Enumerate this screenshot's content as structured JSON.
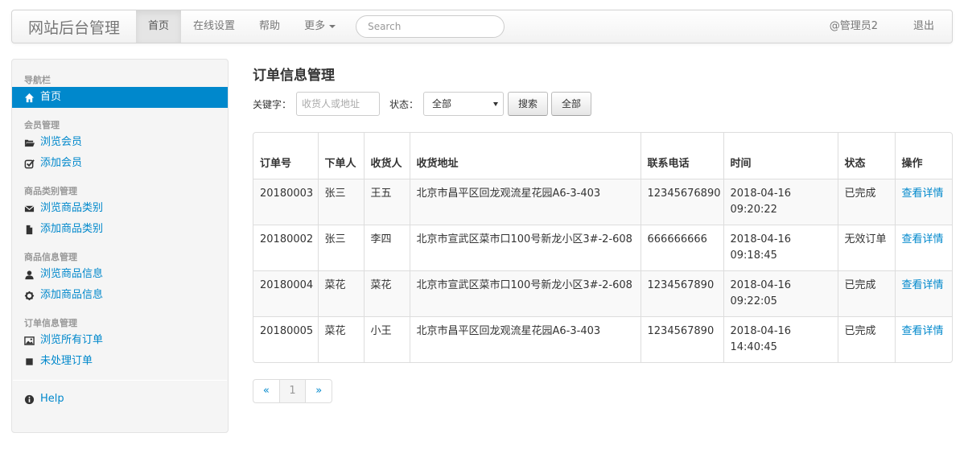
{
  "navbar": {
    "brand": "网站后台管理",
    "items": [
      {
        "label": "首页",
        "active": true
      },
      {
        "label": "在线设置"
      },
      {
        "label": "帮助"
      },
      {
        "label": "更多"
      }
    ],
    "search_placeholder": "Search",
    "user": "@管理员2",
    "logout": "退出"
  },
  "sidebar": {
    "groups": [
      {
        "header": "导航栏",
        "items": [
          {
            "label": "首页",
            "icon": "home-icon",
            "active": true
          }
        ]
      },
      {
        "header": "会员管理",
        "items": [
          {
            "label": "浏览会员",
            "icon": "folder-open-icon"
          },
          {
            "label": "添加会员",
            "icon": "check-square-icon"
          }
        ]
      },
      {
        "header": "商品类别管理",
        "items": [
          {
            "label": "浏览商品类别",
            "icon": "envelope-icon"
          },
          {
            "label": "添加商品类别",
            "icon": "file-icon"
          }
        ]
      },
      {
        "header": "商品信息管理",
        "items": [
          {
            "label": "浏览商品信息",
            "icon": "user-icon"
          },
          {
            "label": "添加商品信息",
            "icon": "gear-icon"
          }
        ]
      },
      {
        "header": "订单信息管理",
        "items": [
          {
            "label": "浏览所有订单",
            "icon": "picture-icon"
          },
          {
            "label": "未处理订单",
            "icon": "stop-icon"
          }
        ]
      }
    ],
    "help": {
      "label": "Help",
      "icon": "info-circle-icon"
    }
  },
  "main": {
    "title": "订单信息管理",
    "filter": {
      "keyword_label": "关键字：",
      "keyword_placeholder": "收货人或地址",
      "status_label": "状态：",
      "status_selected": "全部",
      "search_button": "搜索",
      "all_button": "全部"
    },
    "table": {
      "headers": [
        "订单号",
        "下单人",
        "收货人",
        "收货地址",
        "联系电话",
        "时间",
        "状态",
        "操作"
      ],
      "rows": [
        {
          "order_id": "20180003",
          "buyer": "张三",
          "receiver": "王五",
          "address": "北京市昌平区回龙观流星花园A6-3-403",
          "phone": "12345676890",
          "time": "2018-04-16 09:20:22",
          "status": "已完成",
          "action": "查看详情"
        },
        {
          "order_id": "20180002",
          "buyer": "张三",
          "receiver": "李四",
          "address": "北京市宣武区菜市口100号新龙小区3#-2-608",
          "phone": "666666666",
          "time": "2018-04-16 09:18:45",
          "status": "无效订单",
          "action": "查看详情"
        },
        {
          "order_id": "20180004",
          "buyer": "菜花",
          "receiver": "菜花",
          "address": "北京市宣武区菜市口100号新龙小区3#-2-608",
          "phone": "1234567890",
          "time": "2018-04-16 09:22:05",
          "status": "已完成",
          "action": "查看详情"
        },
        {
          "order_id": "20180005",
          "buyer": "菜花",
          "receiver": "小王",
          "address": "北京市昌平区回龙观流星花园A6-3-403",
          "phone": "1234567890",
          "time": "2018-04-16 14:40:45",
          "status": "已完成",
          "action": "查看详情"
        }
      ]
    },
    "pagination": {
      "prev": "«",
      "current": "1",
      "next": "»"
    }
  },
  "colors": {
    "link": "#0088cc",
    "active_bg": "#0088cc"
  }
}
